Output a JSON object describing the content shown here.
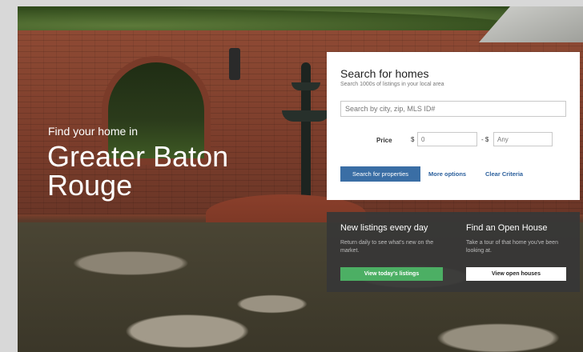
{
  "hero": {
    "tagline": "Find your home in",
    "city": "Greater Baton Rouge"
  },
  "search": {
    "title": "Search for homes",
    "subtitle": "Search 1000s of listings in your local area",
    "placeholder": "Search by city, zip, MLS ID#",
    "price_label": "Price",
    "dollar": "$",
    "min_placeholder": "0",
    "separator": "- $",
    "max_placeholder": "Any",
    "search_button": "Search for properties",
    "more_options": "More options",
    "clear_criteria": "Clear Criteria"
  },
  "promo": {
    "new_listings": {
      "title": "New listings every day",
      "text": "Return daily to see what's new on the market.",
      "button": "View today's listings"
    },
    "open_house": {
      "title": "Find an Open House",
      "text": "Take a tour of that home you've been looking at.",
      "button": "View open houses"
    }
  },
  "colors": {
    "primary_button": "#3a6ea5",
    "green_button": "#4caf64",
    "link": "#2b5f9c",
    "promo_bg": "#373737"
  }
}
